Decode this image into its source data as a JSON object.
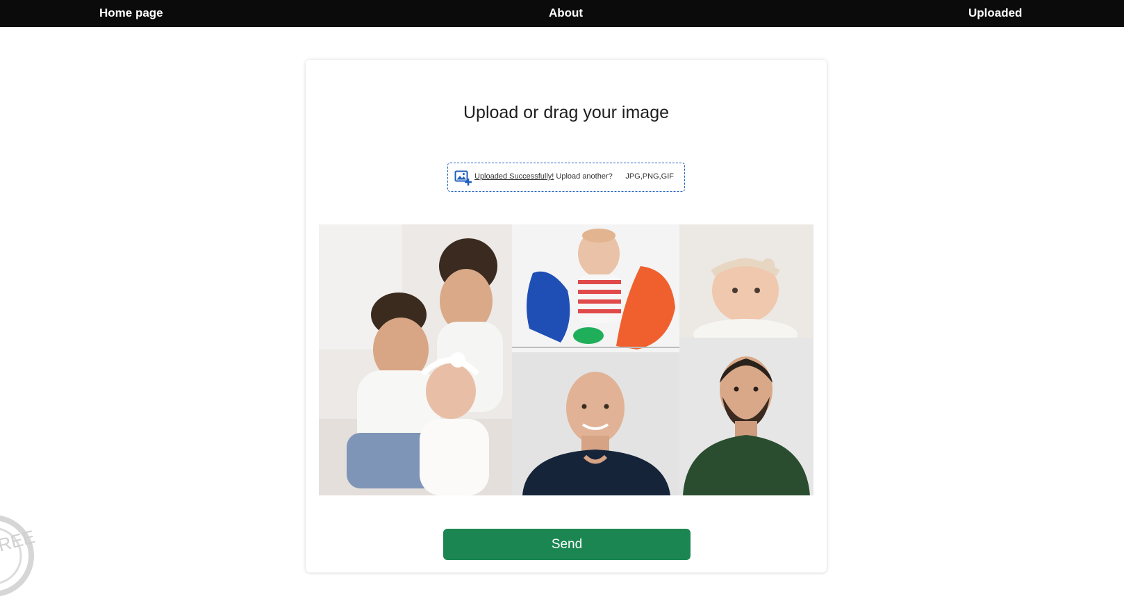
{
  "nav": {
    "home": "Home page",
    "about": "About",
    "uploaded": "Uploaded"
  },
  "upload": {
    "title": "Upload or drag your image",
    "success_link": "Uploaded Successfully!",
    "prompt": " Upload another?",
    "types": "JPG,PNG,GIF",
    "icon": "add-image-icon"
  },
  "collage": {
    "photos": [
      {
        "subject": "three children"
      },
      {
        "subject": "baby with clothes"
      },
      {
        "subject": "newborn baby"
      },
      {
        "subject": "bald man smiling"
      },
      {
        "subject": "bearded man in green shirt"
      }
    ]
  },
  "send": {
    "label": "Send"
  },
  "colors": {
    "nav_bg": "#0b0b0b",
    "accent_blue": "#1f5fbd",
    "send_green": "#1b8652"
  }
}
